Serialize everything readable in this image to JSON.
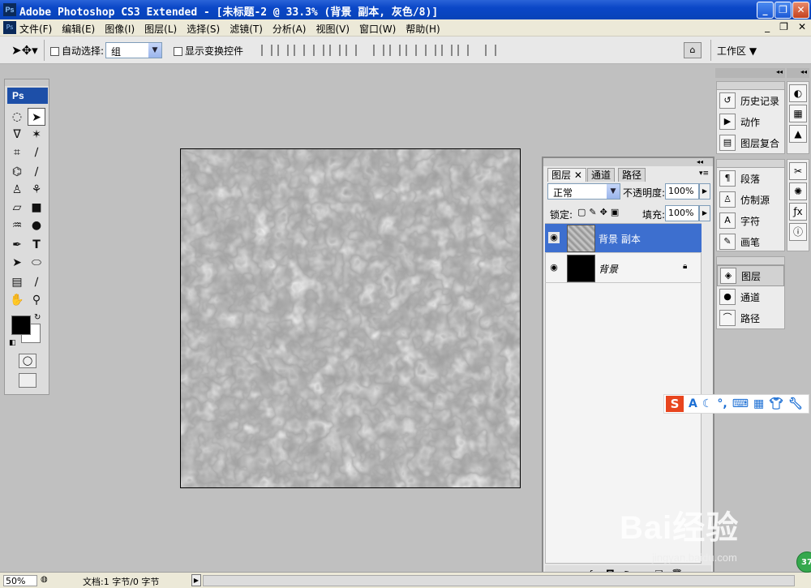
{
  "window": {
    "title": "Adobe Photoshop CS3 Extended - [未标题-2 @ 33.3% (背景 副本, 灰色/8)]",
    "app_icon": "Ps",
    "controls": [
      "_",
      "❐",
      "✕"
    ]
  },
  "menu": {
    "items": [
      "文件(F)",
      "编辑(E)",
      "图像(I)",
      "图层(L)",
      "选择(S)",
      "滤镜(T)",
      "分析(A)",
      "视图(V)",
      "窗口(W)",
      "帮助(H)"
    ],
    "right_controls": [
      "_",
      "❐",
      "✕"
    ]
  },
  "options_bar": {
    "auto_select_label": "自动选择:",
    "auto_select_value": "组",
    "show_transform_label": "显示变换控件",
    "workspace_label": "工作区"
  },
  "toolbox": {
    "logo": "Ps"
  },
  "dock": {
    "group1": [
      "历史记录",
      "动作",
      "图层复合"
    ],
    "group2": [
      "段落",
      "仿制源",
      "字符",
      "画笔"
    ],
    "group3": [
      "图层",
      "通道",
      "路径"
    ]
  },
  "layers_panel": {
    "tabs": [
      "图层",
      "通道",
      "路径"
    ],
    "blend_mode": "正常",
    "opacity_label": "不透明度:",
    "opacity_value": "100%",
    "lock_label": "锁定:",
    "fill_label": "填充:",
    "fill_value": "100%",
    "layers": [
      {
        "name": "背景 副本",
        "selected": true
      },
      {
        "name": "背景",
        "selected": false,
        "locked": true
      }
    ]
  },
  "status": {
    "zoom": "50%",
    "doc_info": "文档:1 字节/0 字节"
  },
  "watermark": {
    "brand": "Bai经验",
    "url": "jingyan.baidu.com"
  },
  "badge": "37",
  "colors": {
    "title_blue": "#0a47c7",
    "selected_layer": "#3d6fcf",
    "canvas_gray": "#9a9a9a"
  }
}
